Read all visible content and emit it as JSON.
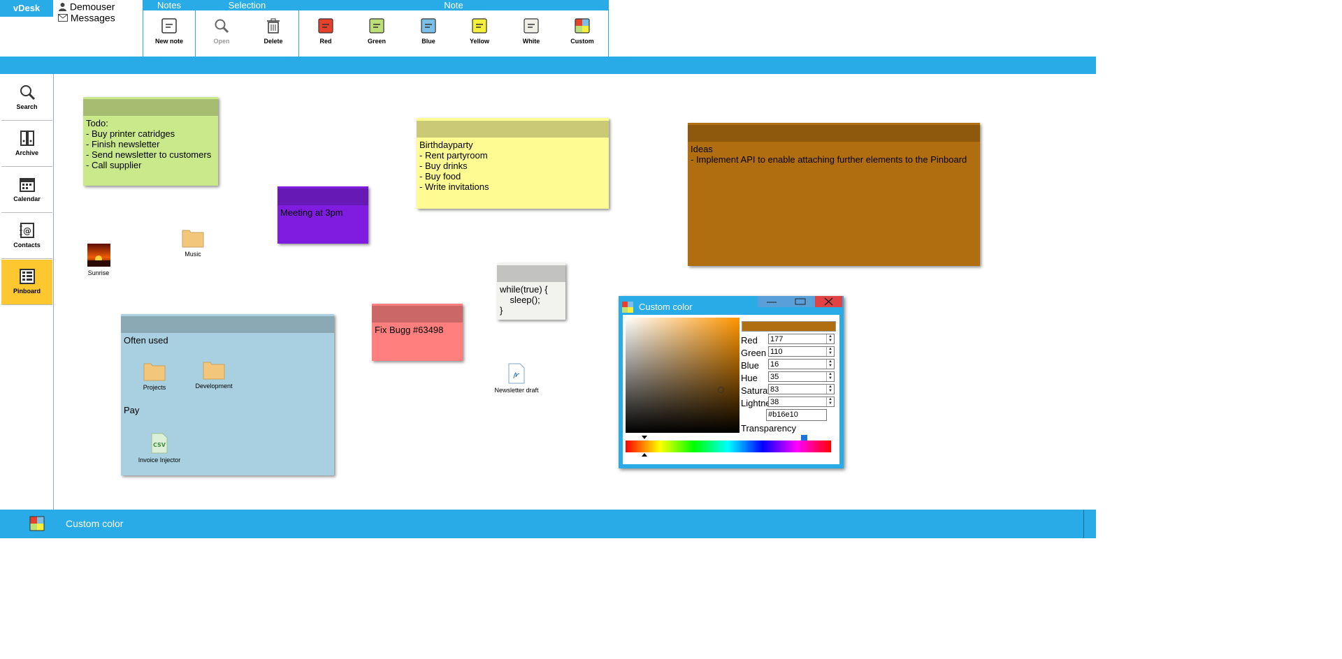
{
  "app": {
    "brand": "vDesk",
    "user": "Demouser",
    "messages": "Messages"
  },
  "ribbon": {
    "groups": [
      {
        "title": "Notes",
        "buttons": [
          {
            "label": "New note"
          }
        ]
      },
      {
        "title": "Selection",
        "buttons": [
          {
            "label": "Open"
          },
          {
            "label": "Delete"
          }
        ]
      },
      {
        "title": "Note",
        "buttons": [
          {
            "label": "Red",
            "color": "#e8412b"
          },
          {
            "label": "Green",
            "color": "#bcdf78"
          },
          {
            "label": "Blue",
            "color": "#7bbfe6"
          },
          {
            "label": "Yellow",
            "color": "#f5f03c"
          },
          {
            "label": "White",
            "color": "#efefe6"
          },
          {
            "label": "Custom"
          }
        ]
      }
    ]
  },
  "sidebar": {
    "items": [
      {
        "label": "Search",
        "icon": "search-icon"
      },
      {
        "label": "Archive",
        "icon": "archive-icon"
      },
      {
        "label": "Calendar",
        "icon": "calendar-icon"
      },
      {
        "label": "Contacts",
        "icon": "contacts-icon"
      },
      {
        "label": "Pinboard",
        "icon": "pinboard-icon",
        "active": true
      }
    ]
  },
  "notes": {
    "todo": {
      "text": "Todo:\n- Buy printer catridges\n- Finish newsletter\n- Send newsletter to customers\n- Call supplier",
      "color": "#cae98a",
      "bar": "#a5bc71"
    },
    "meeting": {
      "text": "Meeting at 3pm",
      "color": "#801ce0",
      "bar": "#6619b4"
    },
    "birthday": {
      "text": "Birthdayparty\n- Rent partyroom\n- Buy drinks\n- Buy food\n- Write invitations",
      "color": "#fdfb92",
      "bar": "#cac976"
    },
    "ideas": {
      "text": "Ideas\n- Implement API to enable attaching further elements to the Pinboard",
      "color": "#b16e10",
      "bar": "#8e590d"
    },
    "code": {
      "text": "while(true) {\n    sleep();\n}",
      "color": "#f2f2ee",
      "bar": "#c2c2c0"
    },
    "bug": {
      "text": "Fix Bugg #63498",
      "color": "#fe7f7e",
      "bar": "#cb6767"
    },
    "often": {
      "title": "Often used",
      "pay": "Pay",
      "color": "#a9d0e0",
      "bar": "#8aa9b5"
    }
  },
  "files": {
    "sunrise": "Sunrise",
    "music": "Music",
    "projects": "Projects",
    "development": "Development",
    "invoice": "Invoice Injector",
    "newsletter": "Newsletter draft"
  },
  "dialog": {
    "title": "Custom color",
    "swatch": "#b16e10",
    "fields": [
      {
        "label": "Red",
        "value": "177"
      },
      {
        "label": "Green",
        "value": "110"
      },
      {
        "label": "Blue",
        "value": "16"
      },
      {
        "label": "Hue",
        "value": "35"
      },
      {
        "label": "Saturation",
        "value": "83"
      },
      {
        "label": "Lightness",
        "value": "38"
      }
    ],
    "hex": "#b16e10",
    "transparency_label": "Transparency"
  },
  "taskbar": {
    "label": "Custom color"
  },
  "colors": {
    "accent": "#29abe8",
    "active": "#fdc82f"
  }
}
